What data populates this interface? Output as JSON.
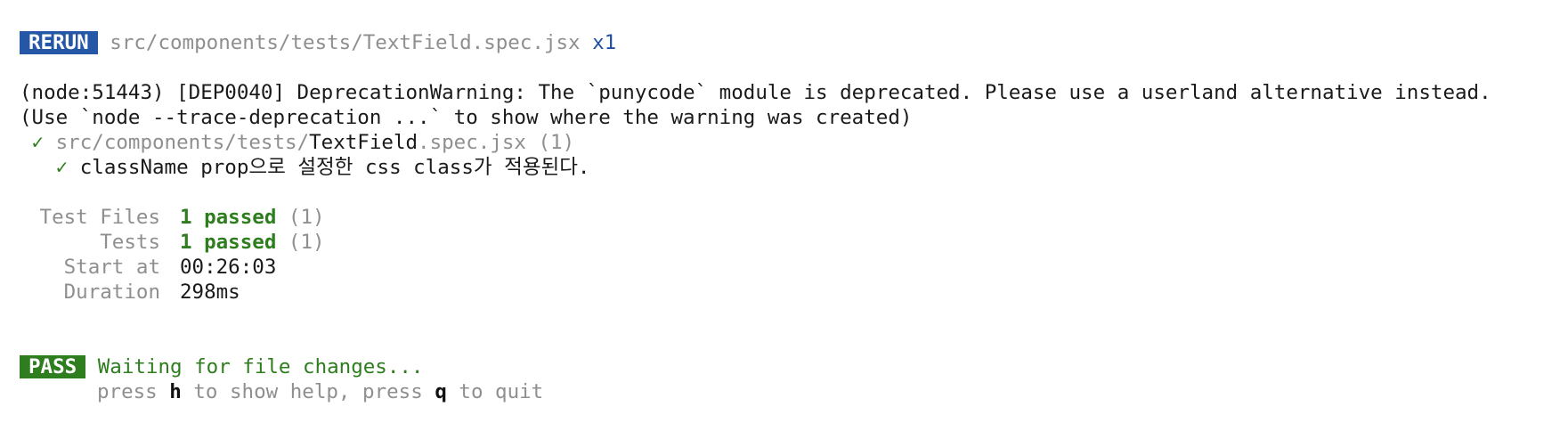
{
  "rerun": {
    "badge": "RERUN",
    "file": "src/components/tests/TextField.spec.jsx",
    "count": "x1"
  },
  "warning": {
    "line1": "(node:51443) [DEP0040] DeprecationWarning: The `punycode` module is deprecated. Please use a userland alternative instead.",
    "line2": "(Use `node --trace-deprecation ...` to show where the warning was created)"
  },
  "suite": {
    "check": "✓",
    "path_dir": "src/components/tests/",
    "path_name": "TextField",
    "path_ext": ".spec.jsx",
    "count": "(1)"
  },
  "test_case": {
    "check": "✓",
    "name": "className prop으로 설정한 css class가 적용된다."
  },
  "summary": {
    "test_files": {
      "label": "Test Files",
      "passed": "1 passed",
      "total": "(1)"
    },
    "tests": {
      "label": "Tests",
      "passed": "1 passed",
      "total": "(1)"
    },
    "start_at": {
      "label": "Start at",
      "value": "00:26:03"
    },
    "duration": {
      "label": "Duration",
      "value": "298ms"
    }
  },
  "status": {
    "badge": "PASS",
    "message": "Waiting for file changes...",
    "help_press1": "press ",
    "help_key1": "h",
    "help_text1": " to show help, press ",
    "help_key2": "q",
    "help_text2": " to quit"
  },
  "colors": {
    "pass_green": "#2e7d1e",
    "rerun_blue": "#2457a6",
    "muted_gray": "#8f8f8f"
  }
}
